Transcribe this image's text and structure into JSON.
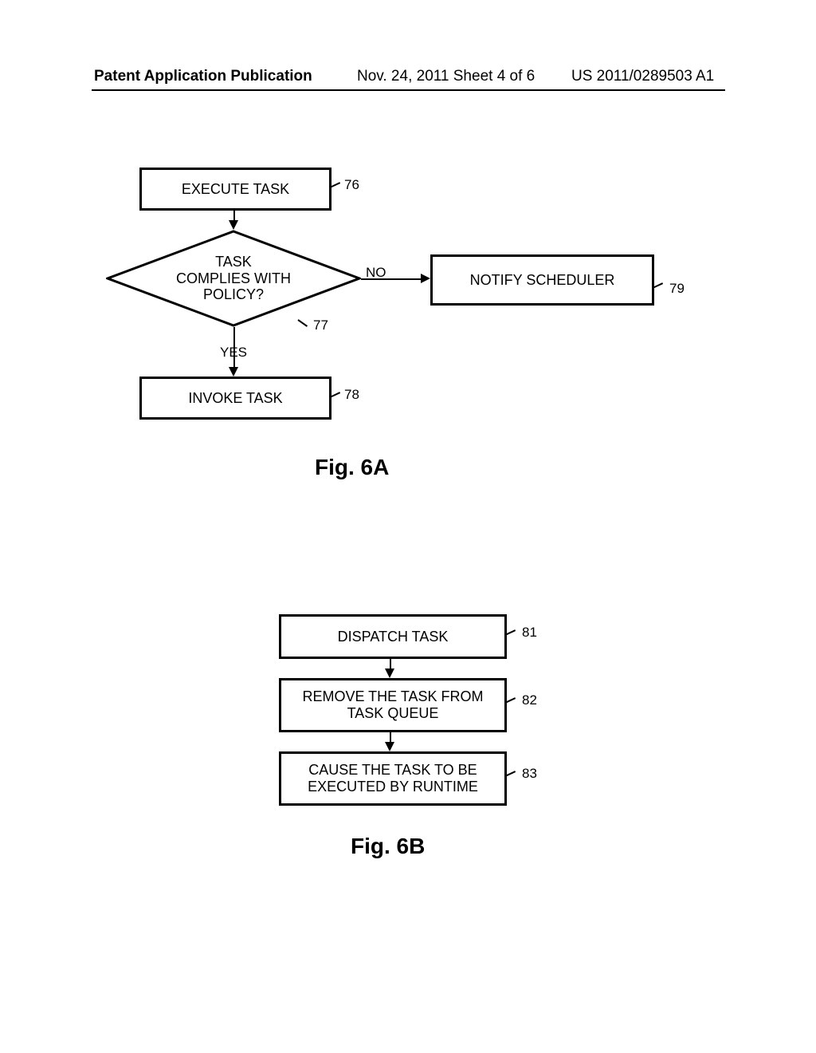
{
  "header": {
    "section_title": "Patent Application Publication",
    "pub_date_sheet": "Nov. 24, 2011  Sheet 4 of 6",
    "pub_number": "US 2011/0289503 A1"
  },
  "fig6a": {
    "caption": "Fig. 6A",
    "box_execute": "EXECUTE TASK",
    "box_execute_ref": "76",
    "decision_text": "TASK\nCOMPLIES WITH\nPOLICY?",
    "decision_ref": "77",
    "decision_yes": "YES",
    "decision_no": "NO",
    "box_notify": "NOTIFY SCHEDULER",
    "box_notify_ref": "79",
    "box_invoke": "INVOKE TASK",
    "box_invoke_ref": "78"
  },
  "fig6b": {
    "caption": "Fig. 6B",
    "box_dispatch": "DISPATCH TASK",
    "box_dispatch_ref": "81",
    "box_remove": "REMOVE THE TASK FROM\nTASK QUEUE",
    "box_remove_ref": "82",
    "box_cause": "CAUSE THE TASK TO BE\nEXECUTED BY RUNTIME",
    "box_cause_ref": "83"
  },
  "chart_data": [
    {
      "type": "flowchart",
      "title": "Fig. 6A",
      "nodes": [
        {
          "id": "76",
          "shape": "process",
          "label": "EXECUTE TASK"
        },
        {
          "id": "77",
          "shape": "decision",
          "label": "TASK COMPLIES WITH POLICY?"
        },
        {
          "id": "78",
          "shape": "process",
          "label": "INVOKE TASK"
        },
        {
          "id": "79",
          "shape": "process",
          "label": "NOTIFY SCHEDULER"
        }
      ],
      "edges": [
        {
          "from": "76",
          "to": "77",
          "label": ""
        },
        {
          "from": "77",
          "to": "78",
          "label": "YES"
        },
        {
          "from": "77",
          "to": "79",
          "label": "NO"
        }
      ]
    },
    {
      "type": "flowchart",
      "title": "Fig. 6B",
      "nodes": [
        {
          "id": "81",
          "shape": "process",
          "label": "DISPATCH TASK"
        },
        {
          "id": "82",
          "shape": "process",
          "label": "REMOVE THE TASK FROM TASK QUEUE"
        },
        {
          "id": "83",
          "shape": "process",
          "label": "CAUSE THE TASK TO BE EXECUTED BY RUNTIME"
        }
      ],
      "edges": [
        {
          "from": "81",
          "to": "82",
          "label": ""
        },
        {
          "from": "82",
          "to": "83",
          "label": ""
        }
      ]
    }
  ]
}
